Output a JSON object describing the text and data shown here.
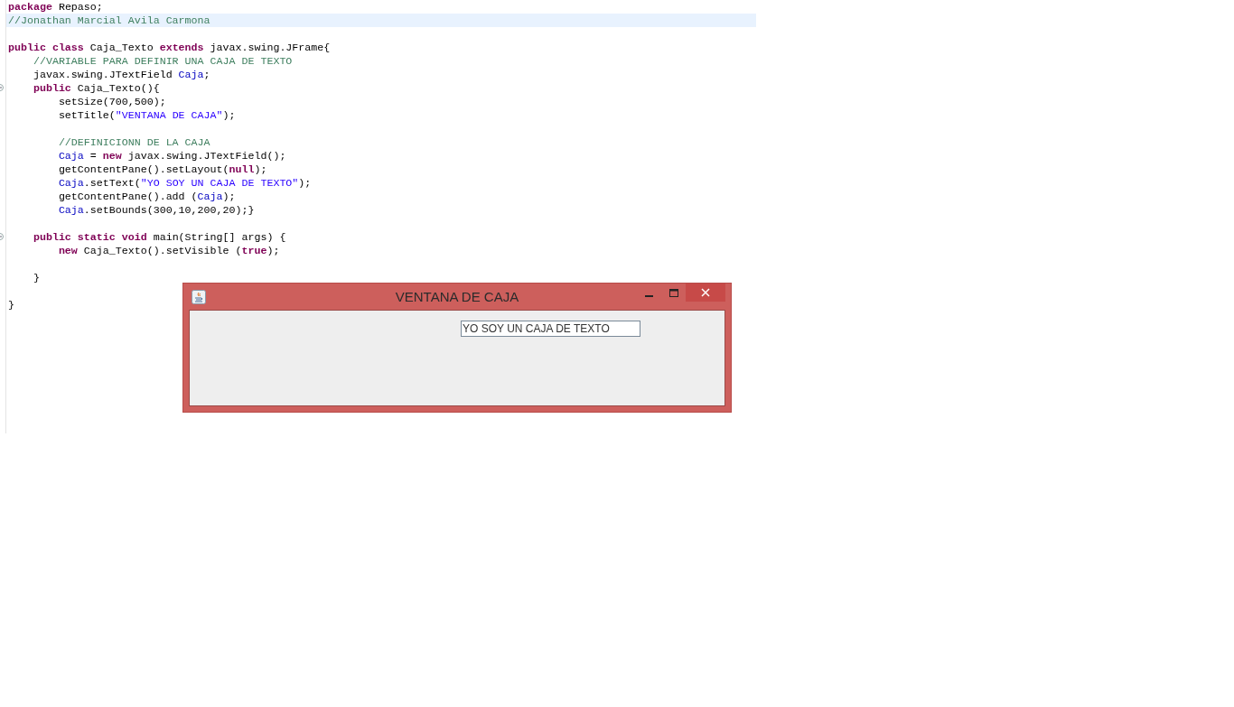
{
  "editor": {
    "lines": [
      {
        "current": false,
        "foldable": false,
        "tokens": [
          {
            "kind": "kw",
            "text": "package"
          },
          {
            "kind": "pl",
            "text": " Repaso;"
          }
        ]
      },
      {
        "current": true,
        "foldable": false,
        "tokens": [
          {
            "kind": "cm",
            "text": "//Jonathan Marcial Avila Carmona"
          }
        ]
      },
      {
        "current": false,
        "foldable": false
      },
      {
        "current": false,
        "foldable": false,
        "tokens": [
          {
            "kind": "kw",
            "text": "public class"
          },
          {
            "kind": "pl",
            "text": " Caja_Texto "
          },
          {
            "kind": "kw",
            "text": "extends"
          },
          {
            "kind": "pl",
            "text": " javax.swing.JFrame{"
          }
        ]
      },
      {
        "current": false,
        "foldable": false,
        "tokens": [
          {
            "kind": "cm",
            "text": "    //VARIABLE PARA DEFINIR UNA CAJA DE TEXTO"
          }
        ]
      },
      {
        "current": false,
        "foldable": false,
        "tokens": [
          {
            "kind": "pl",
            "text": "    javax.swing.JTextField "
          },
          {
            "kind": "fld",
            "text": "Caja"
          },
          {
            "kind": "pl",
            "text": ";"
          }
        ]
      },
      {
        "current": false,
        "foldable": true,
        "tokens": [
          {
            "kind": "kw",
            "text": "    public"
          },
          {
            "kind": "pl",
            "text": " Caja_Texto(){"
          }
        ]
      },
      {
        "current": false,
        "foldable": false,
        "tokens": [
          {
            "kind": "pl",
            "text": "        setSize(700,500);"
          }
        ]
      },
      {
        "current": false,
        "foldable": false,
        "tokens": [
          {
            "kind": "pl",
            "text": "        setTitle("
          },
          {
            "kind": "str",
            "text": "\"VENTANA DE CAJA\""
          },
          {
            "kind": "pl",
            "text": ");"
          }
        ]
      },
      {
        "current": false,
        "foldable": false
      },
      {
        "current": false,
        "foldable": false,
        "tokens": [
          {
            "kind": "cm",
            "text": "        //DEFINICIONN DE LA CAJA"
          }
        ]
      },
      {
        "current": false,
        "foldable": false,
        "tokens": [
          {
            "kind": "fld",
            "text": "        Caja"
          },
          {
            "kind": "pl",
            "text": " = "
          },
          {
            "kind": "kw",
            "text": "new"
          },
          {
            "kind": "pl",
            "text": " javax.swing.JTextField();"
          }
        ]
      },
      {
        "current": false,
        "foldable": false,
        "tokens": [
          {
            "kind": "pl",
            "text": "        getContentPane().setLayout("
          },
          {
            "kind": "kw",
            "text": "null"
          },
          {
            "kind": "pl",
            "text": ");"
          }
        ]
      },
      {
        "current": false,
        "foldable": false,
        "tokens": [
          {
            "kind": "fld",
            "text": "        Caja"
          },
          {
            "kind": "pl",
            "text": ".setText("
          },
          {
            "kind": "str",
            "text": "\"YO SOY UN CAJA DE TEXTO\""
          },
          {
            "kind": "pl",
            "text": ");"
          }
        ]
      },
      {
        "current": false,
        "foldable": false,
        "tokens": [
          {
            "kind": "pl",
            "text": "        getContentPane().add ("
          },
          {
            "kind": "fld",
            "text": "Caja"
          },
          {
            "kind": "pl",
            "text": ");"
          }
        ]
      },
      {
        "current": false,
        "foldable": false,
        "tokens": [
          {
            "kind": "fld",
            "text": "        Caja"
          },
          {
            "kind": "pl",
            "text": ".setBounds(300,10,200,20);}"
          }
        ]
      },
      {
        "current": false,
        "foldable": false
      },
      {
        "current": false,
        "foldable": true,
        "tokens": [
          {
            "kind": "kw",
            "text": "    public static void"
          },
          {
            "kind": "pl",
            "text": " main(String[] args) {"
          }
        ]
      },
      {
        "current": false,
        "foldable": false,
        "tokens": [
          {
            "kind": "kw",
            "text": "        new"
          },
          {
            "kind": "pl",
            "text": " Caja_Texto().setVisible ("
          },
          {
            "kind": "kw",
            "text": "true"
          },
          {
            "kind": "pl",
            "text": ");"
          }
        ]
      },
      {
        "current": false,
        "foldable": false
      },
      {
        "current": false,
        "foldable": false,
        "tokens": [
          {
            "kind": "pl",
            "text": "    }"
          }
        ]
      },
      {
        "current": false,
        "foldable": false
      },
      {
        "current": false,
        "foldable": false,
        "tokens": [
          {
            "kind": "pl",
            "text": "}"
          }
        ]
      }
    ]
  },
  "window": {
    "title": "VENTANA DE CAJA",
    "text_field": {
      "value": "YO SOY UN CAJA DE TEXTO"
    }
  }
}
